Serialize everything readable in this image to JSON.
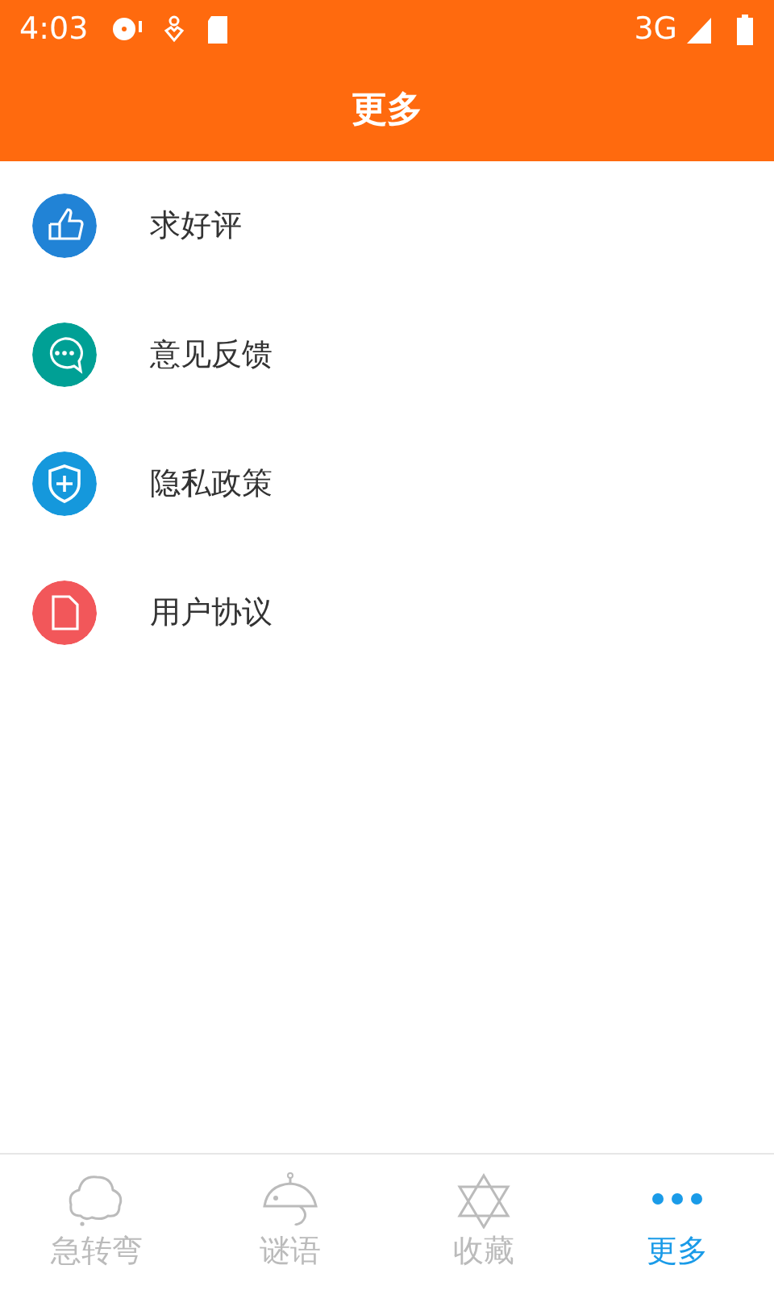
{
  "status_bar": {
    "time": "4:03",
    "network": "3G"
  },
  "title": "更多",
  "menu": [
    {
      "label": "求好评",
      "kind": "thumb",
      "color": "#2183d6"
    },
    {
      "label": "意见反馈",
      "kind": "chat",
      "color": "#00a095"
    },
    {
      "label": "隐私政策",
      "kind": "shield",
      "color": "#1598dc"
    },
    {
      "label": "用户协议",
      "kind": "file",
      "color": "#f2575a"
    }
  ],
  "tabs": [
    {
      "label": "急转弯",
      "kind": "cloud",
      "selected": false
    },
    {
      "label": "谜语",
      "kind": "mouse",
      "selected": false
    },
    {
      "label": "收藏",
      "kind": "star",
      "selected": false
    },
    {
      "label": "更多",
      "kind": "dots",
      "selected": true
    }
  ]
}
